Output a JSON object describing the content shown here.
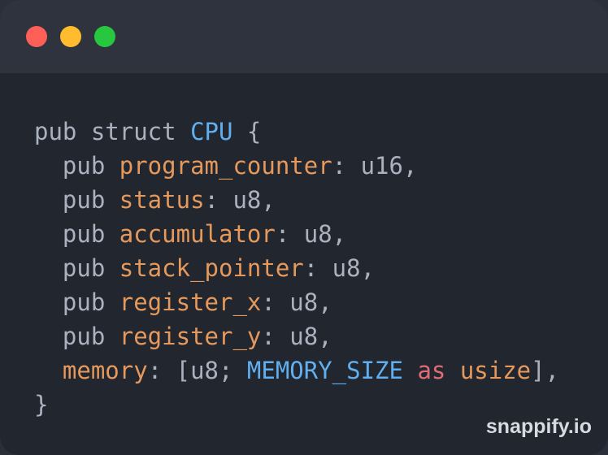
{
  "window": {
    "controls": [
      "close",
      "minimize",
      "maximize"
    ],
    "colors": {
      "close": "#fe5f57",
      "minimize": "#febc2e",
      "maximize": "#27c840"
    }
  },
  "code": {
    "lines": [
      [
        {
          "t": "pub struct ",
          "c": "kw"
        },
        {
          "t": "CPU",
          "c": "type"
        },
        {
          "t": " {",
          "c": "punct"
        }
      ],
      [
        {
          "t": "  pub ",
          "c": "kw"
        },
        {
          "t": "program_counter",
          "c": "field"
        },
        {
          "t": ": u16,",
          "c": "punct"
        }
      ],
      [
        {
          "t": "  pub ",
          "c": "kw"
        },
        {
          "t": "status",
          "c": "field"
        },
        {
          "t": ": u8,",
          "c": "punct"
        }
      ],
      [
        {
          "t": "  pub ",
          "c": "kw"
        },
        {
          "t": "accumulator",
          "c": "field"
        },
        {
          "t": ": u8,",
          "c": "punct"
        }
      ],
      [
        {
          "t": "  pub ",
          "c": "kw"
        },
        {
          "t": "stack_pointer",
          "c": "field"
        },
        {
          "t": ": u8,",
          "c": "punct"
        }
      ],
      [
        {
          "t": "  pub ",
          "c": "kw"
        },
        {
          "t": "register_x",
          "c": "field"
        },
        {
          "t": ": u8,",
          "c": "punct"
        }
      ],
      [
        {
          "t": "  pub ",
          "c": "kw"
        },
        {
          "t": "register_y",
          "c": "field"
        },
        {
          "t": ": u8,",
          "c": "punct"
        }
      ],
      [
        {
          "t": "  ",
          "c": "kw"
        },
        {
          "t": "memory",
          "c": "field"
        },
        {
          "t": ": [u8; ",
          "c": "punct"
        },
        {
          "t": "MEMORY_SIZE",
          "c": "type"
        },
        {
          "t": " ",
          "c": "punct"
        },
        {
          "t": "as",
          "c": "as"
        },
        {
          "t": " ",
          "c": "punct"
        },
        {
          "t": "usize",
          "c": "usize"
        },
        {
          "t": "],",
          "c": "punct"
        }
      ],
      [
        {
          "t": "}",
          "c": "punct"
        }
      ]
    ]
  },
  "watermark": "snappify.io"
}
